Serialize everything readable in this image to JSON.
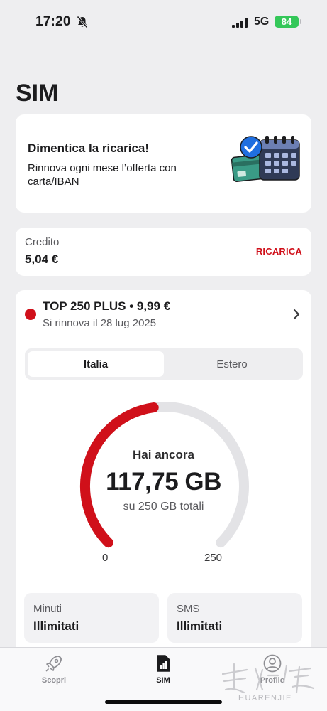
{
  "status_bar": {
    "time": "17:20",
    "network": "5G",
    "battery": "84"
  },
  "page": {
    "title": "SIM"
  },
  "promo": {
    "title": "Dimentica la ricarica!",
    "text": "Rinnova ogni mese l’offerta con carta/IBAN"
  },
  "credit": {
    "label": "Credito",
    "value": "5,04 €",
    "action_label": "RICARICA"
  },
  "plan": {
    "name": "TOP 250 PLUS • 9,99 €",
    "renewal": "Si rinnova il 28 lug 2025",
    "tabs": [
      {
        "label": "Italia",
        "active": true
      },
      {
        "label": "Estero",
        "active": false
      }
    ],
    "gauge": {
      "caption": "Hai ancora",
      "remaining": "117,75 GB",
      "total_text": "su 250 GB totali",
      "min_label": "0",
      "max_label": "250",
      "remaining_fraction": 0.471,
      "colors": {
        "used": "#d0101a",
        "track": "#e3e3e6"
      }
    },
    "allowances": [
      {
        "label": "Minuti",
        "value": "Illimitati"
      },
      {
        "label": "SMS",
        "value": "Illimitati"
      }
    ]
  },
  "tab_bar": {
    "items": [
      {
        "label": "Scopri",
        "icon": "rocket-icon",
        "active": false
      },
      {
        "label": "SIM",
        "icon": "sim-card-icon",
        "active": true
      },
      {
        "label": "Profilo",
        "icon": "user-circle-icon",
        "active": false
      }
    ]
  },
  "watermark": {
    "text": "HUARENJIE"
  },
  "colors": {
    "accent": "#d0101a",
    "background": "#eeeef0",
    "battery": "#34c759"
  }
}
